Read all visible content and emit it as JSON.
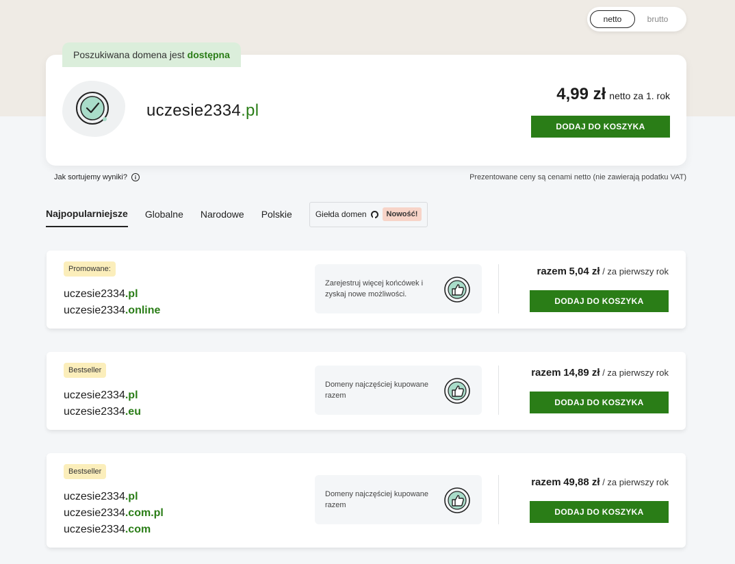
{
  "toggle": {
    "options": [
      "netto",
      "brutto"
    ],
    "selected": "netto"
  },
  "result": {
    "status_prefix": "Poszukiwana domena jest",
    "status_word": "dostępna",
    "domain_name": "uczesie2334",
    "domain_tld": ".pl",
    "price_amount": "4,99 zł",
    "price_suffix": "netto za 1. rok",
    "cta_label": "DODAJ DO KOSZYKA",
    "icon": "check-circle-icon"
  },
  "info": {
    "sort_label": "Jak sortujemy wyniki?",
    "vat_note": "Prezentowane ceny są cenami netto (nie zawierają podatku VAT)"
  },
  "tabs": {
    "items": [
      "Najpopularniejsze",
      "Globalne",
      "Narodowe",
      "Polskie"
    ],
    "active": "Najpopularniejsze",
    "market_label": "Giełda domen",
    "market_badge": "Nowość!"
  },
  "offers": [
    {
      "tag": "Promowane:",
      "domains": [
        {
          "name": "uczesie2334",
          "tld": ".pl"
        },
        {
          "name": "uczesie2334",
          "tld": ".online"
        }
      ],
      "promo_text": "Zarejestruj więcej końcówek i zyskaj nowe możliwości.",
      "price_prefix": "razem",
      "price_amount": "5,04 zł",
      "price_suffix": "/ za pierwszy rok",
      "cta_label": "DODAJ DO KOSZYKA"
    },
    {
      "tag": "Bestseller",
      "domains": [
        {
          "name": "uczesie2334",
          "tld": ".pl"
        },
        {
          "name": "uczesie2334",
          "tld": ".eu"
        }
      ],
      "promo_text": "Domeny najczęściej kupowane razem",
      "price_prefix": "razem",
      "price_amount": "14,89 zł",
      "price_suffix": "/ za pierwszy rok",
      "cta_label": "DODAJ DO KOSZYKA"
    },
    {
      "tag": "Bestseller",
      "domains": [
        {
          "name": "uczesie2334",
          "tld": ".pl"
        },
        {
          "name": "uczesie2334",
          "tld": ".com.pl"
        },
        {
          "name": "uczesie2334",
          "tld": ".com"
        }
      ],
      "promo_text": "Domeny najczęściej kupowane razem",
      "price_prefix": "razem",
      "price_amount": "49,88 zł",
      "price_suffix": "/ za pierwszy rok",
      "cta_label": "DODAJ DO KOSZYKA"
    }
  ],
  "colors": {
    "brand_green": "#2a7d17",
    "badge_green_bg": "#dbeedb",
    "tag_bg": "#fbeebb",
    "new_badge_bg": "#f7d4c8"
  }
}
